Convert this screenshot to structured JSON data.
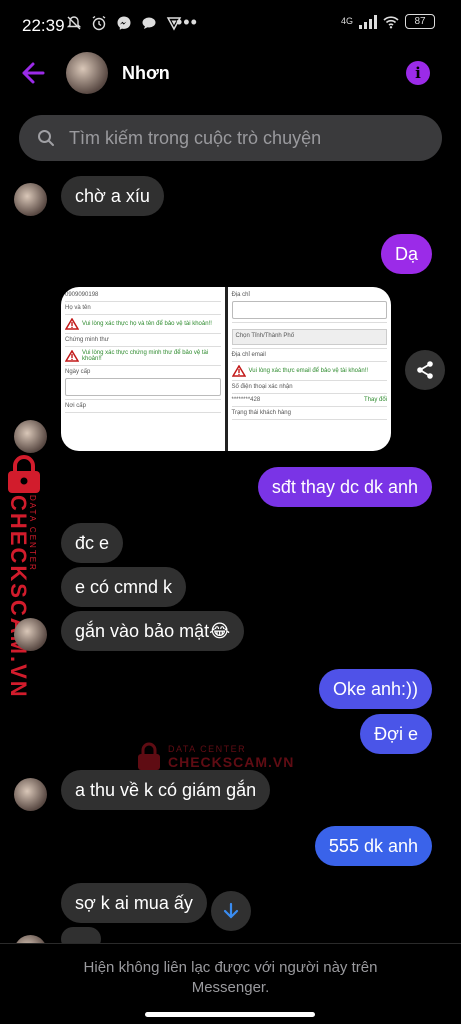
{
  "status": {
    "time": "22:39",
    "network": "4G",
    "battery": "87"
  },
  "header": {
    "contact_name": "Nhơn"
  },
  "search": {
    "placeholder": "Tìm kiếm trong cuộc trò chuyện"
  },
  "messages": [
    {
      "dir": "in",
      "text": "chờ a xíu"
    },
    {
      "dir": "out",
      "text": "Dạ",
      "color": "#9b2be8"
    },
    {
      "dir": "in",
      "type": "photos"
    },
    {
      "dir": "out",
      "text": "sđt thay dc dk anh",
      "color": "#7a34e6"
    },
    {
      "dir": "in",
      "text": "đc e"
    },
    {
      "dir": "in",
      "text": "e có cmnd k"
    },
    {
      "dir": "in",
      "text": "gắn vào bảo mật😂"
    },
    {
      "dir": "out",
      "text": "Oke anh:))",
      "color": "#4f52e8"
    },
    {
      "dir": "out",
      "text": "Đợi e",
      "color": "#4a55e8"
    },
    {
      "dir": "in",
      "text": "a thu về k có giám gắn"
    },
    {
      "dir": "out",
      "text": "555 dk anh",
      "color": "#3a63ea"
    },
    {
      "dir": "in",
      "text": "sợ k ai mua ấy"
    }
  ],
  "photos": {
    "left": {
      "id_line": "0909090198",
      "field1": "Họ và tên",
      "warn1": "Vui lòng xác thực họ và tên để bảo vệ tài khoản!!",
      "field2": "Chứng minh thư",
      "warn2": "Vui lòng xác thực chứng minh thư để bảo vệ tài khoản!!",
      "field3": "Ngày cấp",
      "field4": "Nơi cấp"
    },
    "right": {
      "field1": "Địa chỉ",
      "select": "Chọn Tỉnh/Thành Phố",
      "field2": "Địa chỉ email",
      "warn": "Vui lòng xác thực email để bảo vệ tài khoản!!",
      "field3": "Số điện thoại xác nhận",
      "phone": "********428",
      "change": "Thay đổi",
      "field4": "Trạng thái khách hàng"
    }
  },
  "watermark": {
    "brand": "CHECKSCAM.VN",
    "sub": "DATA CENTER"
  },
  "footer": {
    "line1": "Hiện không liên lạc được với người này trên",
    "line2": "Messenger."
  },
  "colors": {
    "accent": "#9b2be8",
    "incoming_bubble": "#303030",
    "search_bg": "#3a3a3c"
  }
}
